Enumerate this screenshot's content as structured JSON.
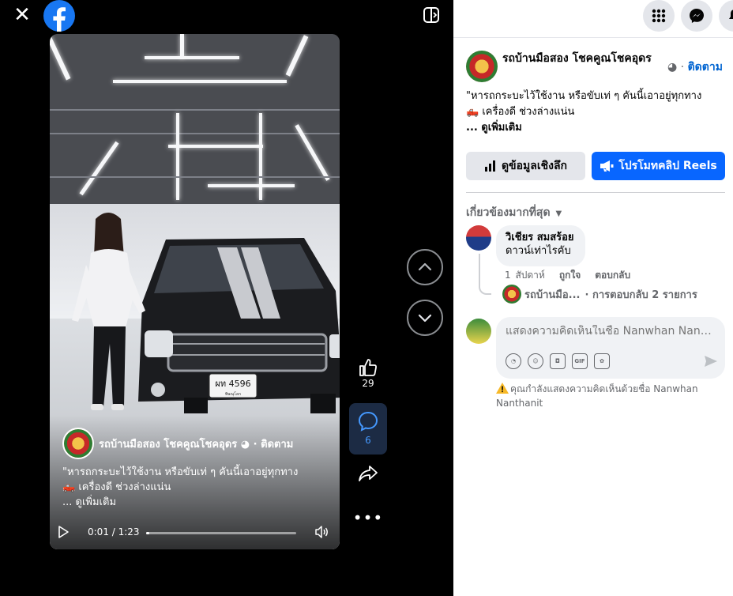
{
  "viewer": {
    "close_label": "✕",
    "logo": "facebook-logo",
    "toggle_icon": "sidebar-toggle-icon"
  },
  "video": {
    "page_name": "รถบ้านมือสอง โชคคูณโชคอุดร",
    "follow_suffix": " · ติดตาม",
    "caption_line1": "\"หารถกระบะไว้ใช้งาน หรือขับเท่ ๆ คันนี้เอาอยู่ทุกทาง",
    "caption_line2": "🛻 เครื่องดี ช่วงล่างแน่น",
    "caption_more": "... ดูเพิ่มเติม",
    "time_display": "0:01 / 1:23",
    "progress_fraction": 0.012,
    "plate": "ผท 4596",
    "plate_sub": "พิษณุโลก"
  },
  "rail": {
    "like_count": "29",
    "comment_count": "6"
  },
  "topbar": {
    "menu_icon": "grid-menu-icon",
    "messenger_icon": "messenger-icon",
    "notifications_icon": "bell-icon"
  },
  "post": {
    "page_name": "รถบ้านมือสอง โชคคูณโชคอุดร",
    "follow_label": "ติดตาม",
    "caption_line1": "\"หารถกระบะไว้ใช้งาน หรือขับเท่ ๆ คันนี้เอาอยู่ทุกทาง",
    "caption_line2": "🛻 เครื่องดี ช่วงล่างแน่น",
    "see_more": "... ดูเพิ่มเติม",
    "insights_label": "ดูข้อมูลเชิงลึก",
    "promote_label": "โปรโมทคลิป Reels"
  },
  "comments": {
    "sort_label": "เกี่ยวข้องมากที่สุด",
    "items": [
      {
        "author": "วิเชียร สมสร้อย",
        "text": "ดาวน์เท่าไรคับ",
        "time": "1 สัปดาห์",
        "like": "ถูกใจ",
        "reply": "ตอบกลับ",
        "reply_summary_name": "รถบ้านมือ...",
        "reply_summary_count": "· การตอบกลับ 2 รายการ"
      }
    ],
    "composer_placeholder": "แสดงความคิดเห็นในชื่อ Nanwhan Nanthanit",
    "notice": "คุณกำลังแสดงความคิดเห็นด้วยชื่อ Nanwhan Nanthanit"
  },
  "colors": {
    "brand_blue": "#0866ff",
    "link_blue": "#0064d1"
  }
}
